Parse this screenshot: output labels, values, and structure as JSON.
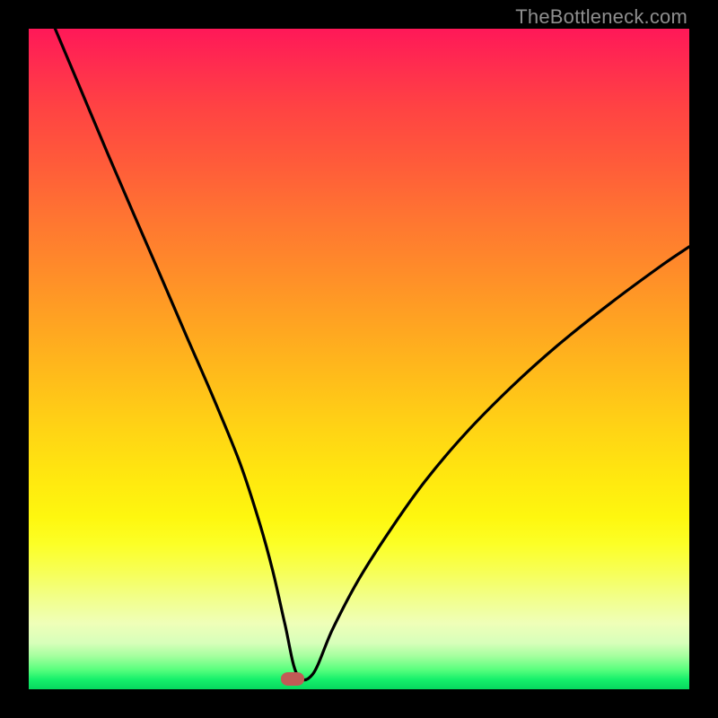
{
  "watermark": "TheBottleneck.com",
  "colors": {
    "frame": "#000000",
    "curve": "#000000",
    "marker": "#c15b56"
  },
  "chart_data": {
    "type": "line",
    "title": "",
    "xlabel": "",
    "ylabel": "",
    "xlim": [
      0,
      100
    ],
    "ylim": [
      0,
      100
    ],
    "grid": false,
    "legend": false,
    "note": "Axes are implicit (0–100 each). Values read from pixel positions; curve resembles |log-distance| bottleneck shape with a minimum near x≈40.",
    "series": [
      {
        "name": "bottleneck-curve",
        "x": [
          4,
          8,
          12,
          16,
          20,
          24,
          28,
          32,
          35,
          37,
          38.8,
          40.6,
          43,
          46,
          50,
          55,
          60,
          66,
          73,
          80,
          88,
          96,
          100
        ],
        "values": [
          100,
          90.5,
          81,
          71.7,
          62.5,
          53.2,
          44,
          34.2,
          25,
          17.7,
          9.8,
          2.3,
          2.3,
          9.1,
          16.7,
          24.5,
          31.5,
          38.6,
          45.7,
          52,
          58.4,
          64.3,
          67
        ]
      }
    ],
    "marker": {
      "x": 40,
      "y": 1.5
    }
  }
}
